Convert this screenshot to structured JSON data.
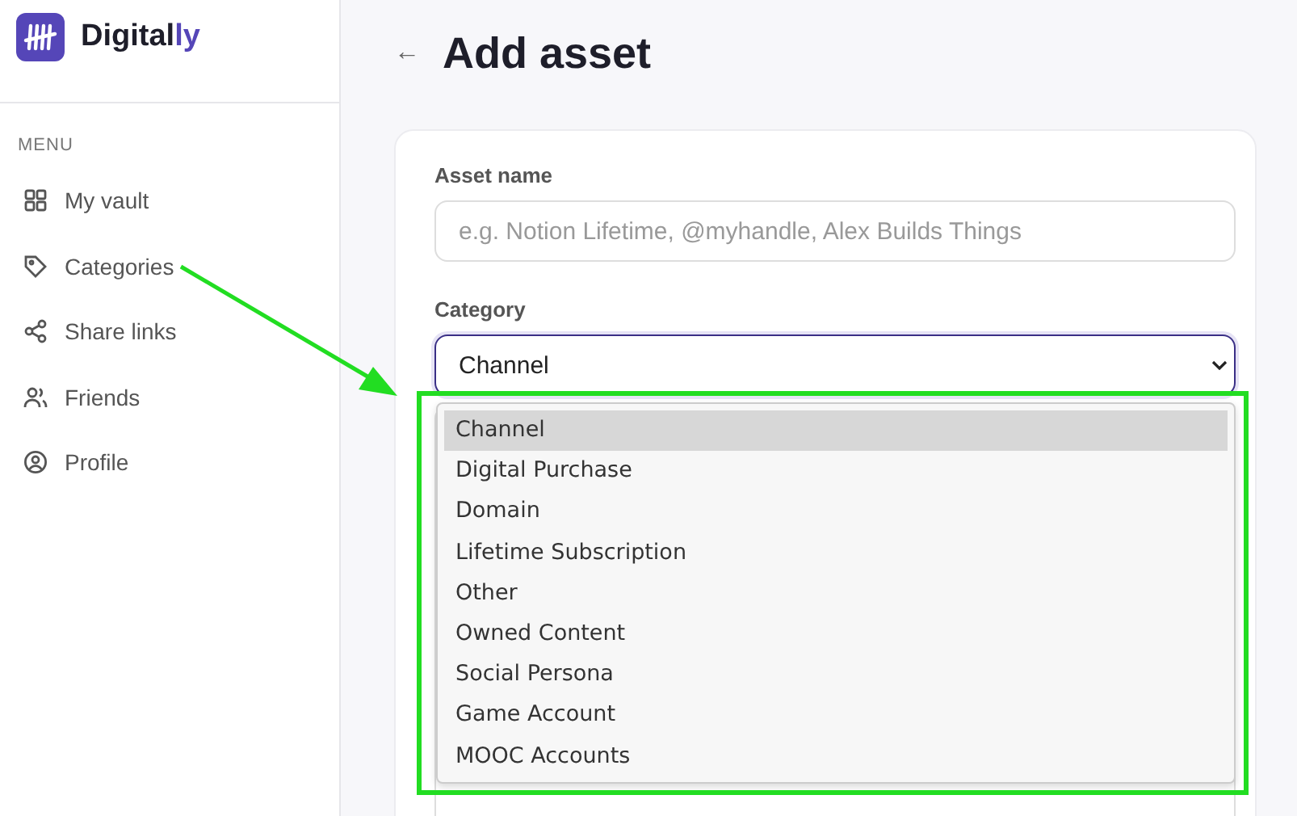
{
  "sidebar": {
    "brand": {
      "name": "Digital",
      "accent": "ly"
    },
    "menu_label": "MENU",
    "items": [
      {
        "label": "My vault"
      },
      {
        "label": "Categories"
      },
      {
        "label": "Share links"
      },
      {
        "label": "Friends"
      },
      {
        "label": "Profile"
      }
    ]
  },
  "page": {
    "back": "←",
    "title": "Add asset"
  },
  "form": {
    "asset_name": {
      "label": "Asset name",
      "placeholder": "e.g. Notion Lifetime, @myhandle, Alex Builds Things"
    },
    "category": {
      "label": "Category",
      "value": "Channel",
      "expanded": true,
      "options": [
        {
          "label": "Channel",
          "selected": true
        },
        {
          "label": "Digital Purchase",
          "selected": false
        },
        {
          "label": "Domain",
          "selected": false
        },
        {
          "label": "Lifetime Subscription",
          "selected": false
        },
        {
          "label": "Other",
          "selected": false
        },
        {
          "label": "Owned Content",
          "selected": false
        },
        {
          "label": "Social Persona",
          "selected": false
        },
        {
          "label": "Game Account",
          "selected": false
        },
        {
          "label": "MOOC Accounts",
          "selected": false
        }
      ]
    }
  },
  "annotation": {
    "color": "#22dd22"
  }
}
